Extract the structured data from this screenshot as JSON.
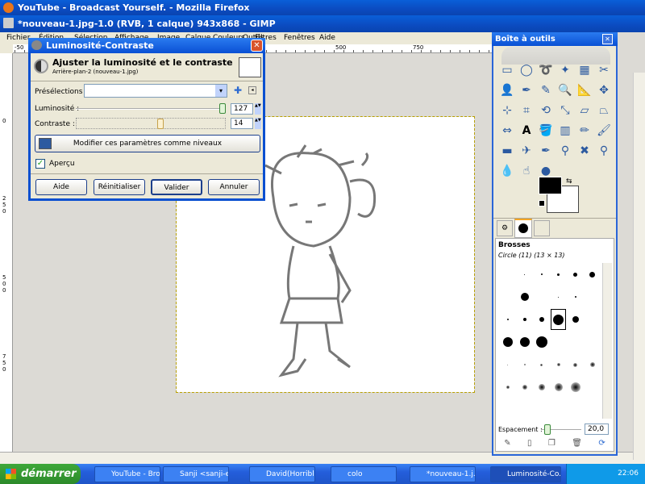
{
  "firefox_title": "YouTube - Broadcast Yourself. - Mozilla Firefox",
  "gimp_title": "*nouveau-1.jpg-1.0 (RVB, 1 calque) 943x868 - GIMP",
  "menu": [
    "Fichier",
    "Édition",
    "Sélection",
    "Affichage",
    "Image",
    "Calque",
    "Couleurs",
    "Outils",
    "Filtres",
    "Fenêtres",
    "Aide"
  ],
  "ruler": {
    "h": [
      "-50",
      "500",
      "750"
    ],
    "v": [
      "0",
      "2 5 0",
      "5 0 0",
      "7 5 0"
    ]
  },
  "dialog": {
    "title": "Luminosité-Contraste",
    "heading": "Ajuster la luminosité et le contraste",
    "subheading": "Arrière-plan-2 (nouveau-1.jpg)",
    "presets_label": "Présélections :",
    "presets_value": "",
    "brightness_label": "Luminosité :",
    "brightness_value": "127",
    "brightness_fraction": 1.0,
    "contrast_label": "Contraste :",
    "contrast_value": "14",
    "contrast_fraction": 0.56,
    "levels_button": "Modifier ces paramètres comme niveaux",
    "preview_label": "Aperçu",
    "preview_checked": true,
    "buttons": {
      "help": "Aide",
      "reset": "Réinitialiser",
      "ok": "Valider",
      "cancel": "Annuler"
    }
  },
  "toolbox": {
    "title": "Boîte à outils",
    "tools": [
      "rect-select",
      "ellipse-select",
      "free-select",
      "fuzzy-select",
      "color-select",
      "scissors",
      "foreground-select",
      "paths",
      "color-picker",
      "zoom",
      "measure",
      "move",
      "align",
      "crop",
      "rotate",
      "scale",
      "shear",
      "perspective",
      "flip",
      "text",
      "bucket-fill",
      "blend",
      "pencil",
      "paintbrush",
      "eraser",
      "airbrush",
      "ink",
      "clone",
      "heal",
      "perspective-clone",
      "blur",
      "smudge",
      "dodge-burn"
    ],
    "fg_color": "#000000",
    "bg_color": "#ffffff",
    "brushes_title": "Brosses",
    "brush_name": "Circle (11) (13 × 13)",
    "spacing_label": "Espacement :",
    "spacing_value": "20,0"
  },
  "taskbar": {
    "start": "démarrer",
    "tasks": [
      "YouTube - Bro...",
      "Sanji <sanji-e...",
      "David(Horrible...",
      "colo",
      "*nouveau-1.j...",
      "Luminosité-Co..."
    ],
    "clock": "22:06"
  }
}
